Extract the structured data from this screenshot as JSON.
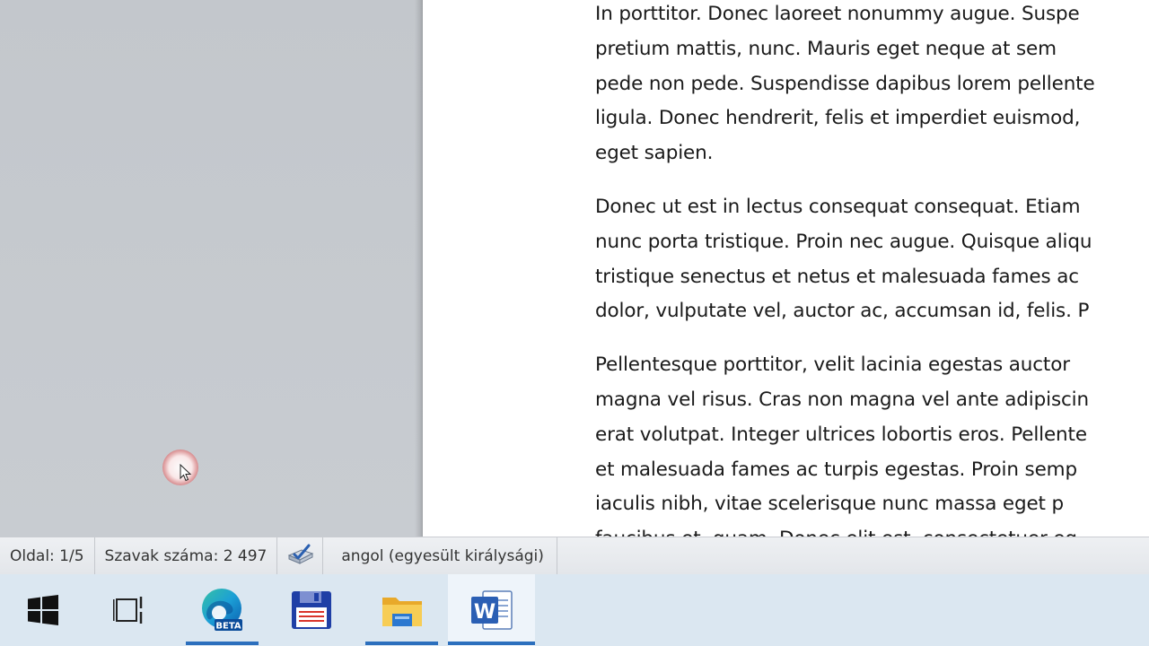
{
  "document": {
    "paragraphs": [
      [
        "In porttitor. Donec laoreet nonummy augue. Suspe",
        "pretium mattis, nunc. Mauris eget neque at sem",
        "pede non pede. Suspendisse dapibus lorem pellente",
        "ligula. Donec hendrerit, felis et imperdiet euismod,",
        "eget sapien."
      ],
      [
        "Donec ut est in lectus consequat consequat. Etiam",
        "nunc porta tristique. Proin nec augue. Quisque aliqu",
        "tristique senectus et netus et malesuada fames ac",
        "dolor, vulputate vel, auctor ac, accumsan id, felis. P"
      ],
      [
        "Pellentesque porttitor, velit lacinia egestas auctor",
        "magna vel risus. Cras non magna vel ante adipiscin",
        "erat volutpat. Integer ultrices lobortis eros. Pellente",
        "et malesuada fames ac turpis egestas. Proin semp",
        "iaculis nibh, vitae scelerisque nunc massa eget p",
        "faucibus et, quam. Donec elit est, consectetuer eg"
      ]
    ]
  },
  "statusbar": {
    "page": "Oldal: 1/5",
    "words": "Szavak száma: 2 497",
    "proofing_icon": "proofing-check-icon",
    "language": "angol (egyesült királysági)"
  },
  "taskbar": {
    "items": [
      {
        "name": "windows-start-icon"
      },
      {
        "name": "task-view-icon"
      },
      {
        "name": "edge-beta-icon",
        "badge": "BETA"
      },
      {
        "name": "floppy-save-icon"
      },
      {
        "name": "file-explorer-icon"
      },
      {
        "name": "word-icon",
        "letter": "W"
      }
    ]
  },
  "colors": {
    "accent": "#2c6fbd",
    "taskbar_bg": "#dbe7f1",
    "workspace_bg": "#c4c8cd"
  }
}
